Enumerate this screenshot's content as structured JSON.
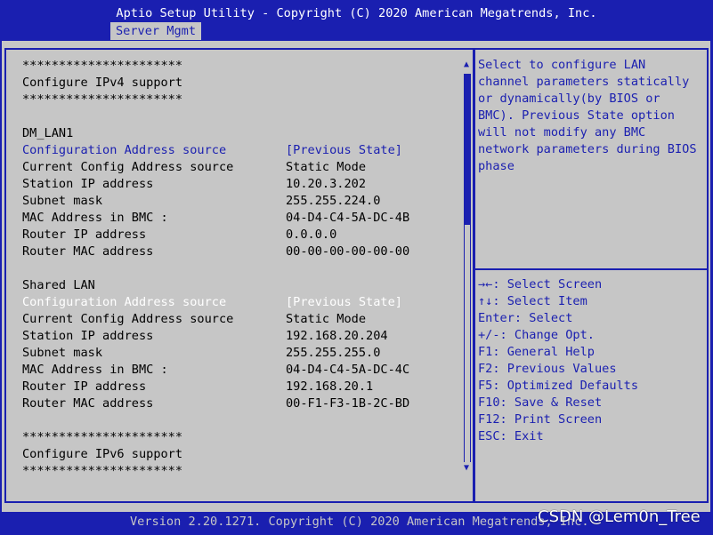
{
  "header": {
    "title": "Aptio Setup Utility - Copyright (C) 2020 American Megatrends, Inc.",
    "active_tab": "Server Mgmt"
  },
  "main": {
    "stars": "**********************",
    "ipv4_heading": "Configure IPv4 support",
    "dm_lan1": {
      "label": "DM_LAN1",
      "config_source_label": "Configuration Address source",
      "config_source_value": "[Previous State]",
      "current_config_label": "Current Config Address source",
      "current_config_value": "Static Mode",
      "station_ip_label": "Station IP address",
      "station_ip_value": "10.20.3.202",
      "subnet_label": "Subnet mask",
      "subnet_value": "255.255.224.0",
      "mac_bmc_label": "MAC Address in BMC :",
      "mac_bmc_value": "04-D4-C4-5A-DC-4B",
      "router_ip_label": "Router IP address",
      "router_ip_value": "0.0.0.0",
      "router_mac_label": "Router MAC address",
      "router_mac_value": "00-00-00-00-00-00"
    },
    "shared_lan": {
      "label": "Shared LAN",
      "config_source_label": "Configuration Address source",
      "config_source_value": "[Previous State]",
      "current_config_label": "Current Config Address source",
      "current_config_value": "Static Mode",
      "station_ip_label": "Station IP address",
      "station_ip_value": "192.168.20.204",
      "subnet_label": "Subnet mask",
      "subnet_value": "255.255.255.0",
      "mac_bmc_label": "MAC Address in BMC :",
      "mac_bmc_value": "04-D4-C4-5A-DC-4C",
      "router_ip_label": "Router IP address",
      "router_ip_value": "192.168.20.1",
      "router_mac_label": "Router MAC address",
      "router_mac_value": "00-F1-F3-1B-2C-BD"
    },
    "ipv6_heading": "Configure IPv6 support"
  },
  "help": {
    "lines": [
      "Select to configure LAN",
      "channel parameters statically",
      "or dynamically(by BIOS or",
      "BMC). Previous State option",
      "will not modify any BMC",
      "network parameters during BIOS",
      "phase"
    ]
  },
  "keys": [
    "→←: Select Screen",
    "↑↓: Select Item",
    "Enter: Select",
    "+/-: Change Opt.",
    "F1: General Help",
    "F2: Previous Values",
    "F5: Optimized Defaults",
    "F10: Save & Reset",
    "F12: Print Screen",
    "ESC: Exit"
  ],
  "footer": {
    "text": "Version 2.20.1271. Copyright (C) 2020 American Megatrends, Inc.",
    "watermark": "CSDN @Lem0n_Tree"
  },
  "colors": {
    "bios_blue": "#1a1fb0",
    "panel_gray": "#c6c6c6",
    "highlight_white": "#ffffff"
  },
  "scrollbar": {
    "up_icon": "▲",
    "down_icon": "▼"
  }
}
